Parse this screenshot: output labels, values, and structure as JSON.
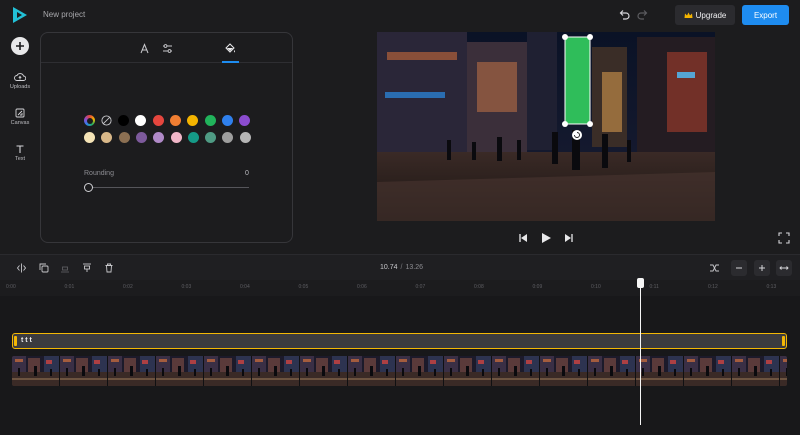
{
  "header": {
    "project_name": "New project",
    "upgrade_label": "Upgrade",
    "export_label": "Export"
  },
  "rail": {
    "uploads_label": "Uploads",
    "canvas_label": "Canvas",
    "text_label": "Text"
  },
  "panel": {
    "tabs": [
      "text-tab",
      "adjust-tab",
      "fill-tab"
    ],
    "active_tab": "fill-tab",
    "color_row1": [
      "#000000",
      "#ffffff",
      "#e5463e",
      "#f07e32",
      "#f4b400",
      "#21b35b",
      "#2f80ed",
      "#8b4ccf"
    ],
    "color_row2": [
      "#f4e3b6",
      "#d9b889",
      "#8b6f52",
      "#7d5a9c",
      "#b08ac8",
      "#f1b6c8",
      "#159a87",
      "#4f9b84",
      "#9e9e9e",
      "#b5b5b5"
    ],
    "rounding_label": "Rounding",
    "rounding_value": "0"
  },
  "timecode": {
    "current": "10.74",
    "separator": "/",
    "total": "13.26"
  },
  "ruler_ticks": [
    "0:00",
    "0:01",
    "0:02",
    "0:03",
    "0:04",
    "0:05",
    "0:06",
    "0:07",
    "0:08",
    "0:09",
    "0:10",
    "0:11",
    "0:12",
    "0:13"
  ],
  "text_clip_label": "t t t",
  "accent": "#1e8cf0",
  "clip_highlight": "#f2b705",
  "shape_color": "#2fbd5a"
}
